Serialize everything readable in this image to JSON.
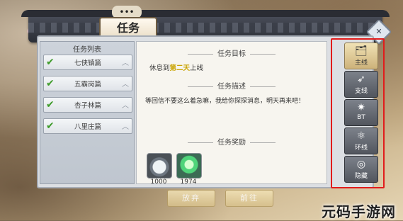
{
  "header": {
    "title": "任务",
    "crown_text": "•••"
  },
  "left_panel": {
    "title": "任务列表",
    "items": [
      {
        "label": "七侠镇篇"
      },
      {
        "label": "五霸岗篇"
      },
      {
        "label": "杏子林篇"
      },
      {
        "label": "八里庄篇"
      }
    ]
  },
  "content": {
    "goal_title": "任务目标",
    "goal_prefix": "休息到",
    "goal_highlight": "第二天",
    "goal_suffix": "上线",
    "desc_title": "任务描述",
    "desc_text": "等回信不要这么着急嘛，我给你探探消息，明天再来吧！",
    "reward_title": "任务奖励",
    "rewards": [
      {
        "count": "1000"
      },
      {
        "count": "1974"
      }
    ]
  },
  "buttons": {
    "abandon": "放弃",
    "goto": "前往"
  },
  "tabs": [
    {
      "label": "主线",
      "icon": "🗂"
    },
    {
      "label": "支线",
      "icon": "➶"
    },
    {
      "label": "BT",
      "icon": "✷"
    },
    {
      "label": "环线",
      "icon": "⚛"
    },
    {
      "label": "隐藏",
      "icon": "◎"
    }
  ],
  "watermark": "元码手游网",
  "colors": {
    "highlight": "#c9a300",
    "check": "#3e9b2a",
    "tab_border": "#e11c1c"
  }
}
